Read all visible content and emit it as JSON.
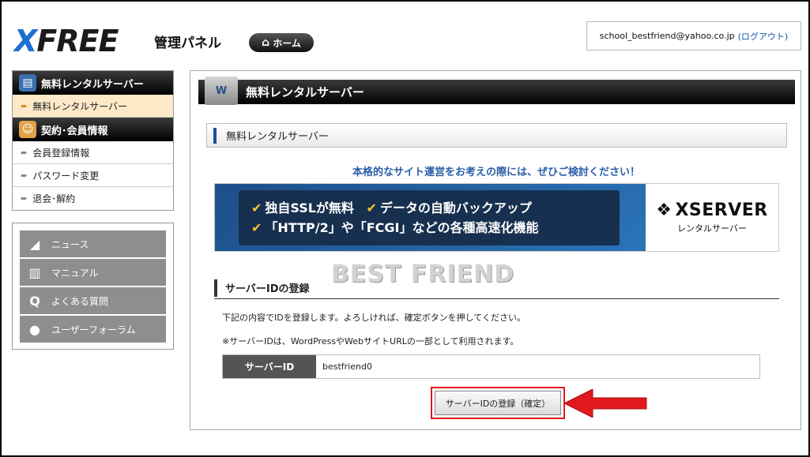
{
  "header": {
    "logo": "XFREE",
    "panel_title": "管理パネル",
    "home_label": "ホーム",
    "user_email": "school_bestfriend@yahoo.co.jp",
    "logout_label": "(ログアウト)"
  },
  "sidebar": {
    "sections": [
      {
        "title": "無料レンタルサーバー",
        "icon": "server-icon",
        "items": [
          {
            "label": "無料レンタルサーバー",
            "active": true
          }
        ]
      },
      {
        "title": "契約･会員情報",
        "icon": "user-icon",
        "items": [
          {
            "label": "会員登録情報"
          },
          {
            "label": "パスワード変更"
          },
          {
            "label": "退会･解約"
          }
        ]
      }
    ],
    "links": [
      {
        "label": "ニュース",
        "icon": "megaphone-icon"
      },
      {
        "label": "マニュアル",
        "icon": "book-icon"
      },
      {
        "label": "よくある質問",
        "icon": "q-icon"
      },
      {
        "label": "ユーザーフォーラム",
        "icon": "chat-icon"
      }
    ]
  },
  "main": {
    "title": "無料レンタルサーバー",
    "subtitle": "無料レンタルサーバー",
    "promo_text": "本格的なサイト運営をお考えの際には、ぜひご検討ください！",
    "banner": {
      "line1a": "独自SSLが無料",
      "line1b": "データの自動バックアップ",
      "line2": "「HTTP/2」や「FCGI」などの各種高速化機能",
      "brand": "XSERVER",
      "brand_sub": "レンタルサーバー"
    },
    "watermark": "BEST FRIEND",
    "section_title": "サーバーIDの登録",
    "desc1": "下記の内容でIDを登録します。よろしければ、確定ボタンを押してください。",
    "desc2": "※サーバーIDは、WordPressやWebサイトURLの一部として利用されます。",
    "id_label": "サーバーID",
    "id_value": "bestfriend0",
    "confirm_label": "サーバーIDの登録（確定）"
  },
  "colors": {
    "accent_blue": "#1e6fd0",
    "header_black": "#000000",
    "highlight_red": "#e0191e",
    "active_bg": "#fde9c7"
  }
}
